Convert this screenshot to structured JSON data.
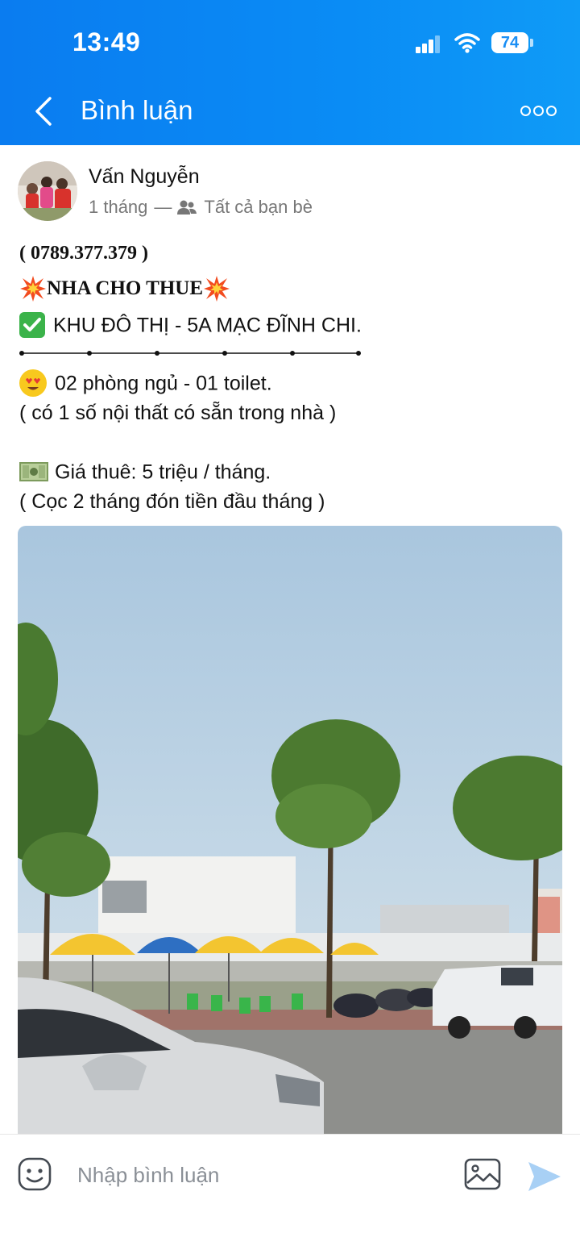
{
  "status_bar": {
    "time": "13:49",
    "battery": "74"
  },
  "header": {
    "title": "Bình luận",
    "back_icon": "chevron-left-icon",
    "more_icon": "more-dots-icon",
    "background": "#0a86f3"
  },
  "post": {
    "author": "Vấn Nguyễn",
    "time_ago": "1 tháng",
    "separator": "—",
    "audience": "Tất cả bạn bè",
    "lines": {
      "phone": "(  0789.377.379  )",
      "headline": "NHA CHO THUE",
      "location": "KHU ĐÔ THỊ - 5A MẠC ĐĨNH CHI.",
      "rooms": "02 phòng ngủ - 01 toilet.",
      "furniture": "( có 1 số nội thất có sẵn trong nhà )",
      "price": "Giá thuê: 5 triệu / tháng.",
      "deposit": "( Cọc 2 tháng đón tiền đầu tháng )"
    }
  },
  "comment_bar": {
    "placeholder": "Nhập bình luận",
    "sticker_icon": "sticker-smile-icon",
    "image_icon": "image-icon",
    "send_icon": "send-icon",
    "send_color": "#a8d0f5"
  }
}
